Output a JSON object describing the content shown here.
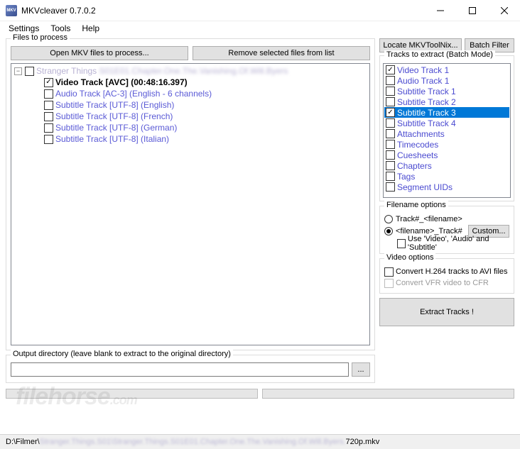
{
  "window": {
    "title": "MKVcleaver 0.7.0.2"
  },
  "menu": [
    "Settings",
    "Tools",
    "Help"
  ],
  "left": {
    "files_legend": "Files to process",
    "open_btn": "Open MKV files to process...",
    "remove_btn": "Remove selected files from list",
    "file_label_prefix": "Stranger Things ",
    "file_label_mid": "S01E01.Chapter.One.The.Vanishing.Of.Will.Byers",
    "tracks": [
      {
        "label": "Video Track [AVC] (00:48:16.397)",
        "checked": true,
        "bold": true
      },
      {
        "label": "Audio Track [AC-3] (English - 6 channels)",
        "checked": false,
        "bold": false
      },
      {
        "label": "Subtitle Track [UTF-8] (English)",
        "checked": false,
        "bold": false
      },
      {
        "label": "Subtitle Track [UTF-8] (French)",
        "checked": false,
        "bold": false
      },
      {
        "label": "Subtitle Track [UTF-8] (German)",
        "checked": false,
        "bold": false
      },
      {
        "label": "Subtitle Track [UTF-8] (Italian)",
        "checked": false,
        "bold": false
      }
    ],
    "out_legend": "Output directory (leave blank to extract to the original directory)",
    "out_value": "",
    "browse": "..."
  },
  "right": {
    "locate_btn": "Locate MKVToolNix...",
    "batch_btn": "Batch Filter",
    "tracks_legend": "Tracks to extract (Batch Mode)",
    "items": [
      {
        "label": "Video Track 1",
        "checked": true,
        "selected": false
      },
      {
        "label": "Audio Track 1",
        "checked": false,
        "selected": false
      },
      {
        "label": "Subtitle Track 1",
        "checked": false,
        "selected": false
      },
      {
        "label": "Subtitle Track 2",
        "checked": false,
        "selected": false
      },
      {
        "label": "Subtitle Track 3",
        "checked": true,
        "selected": true
      },
      {
        "label": "Subtitle Track 4",
        "checked": false,
        "selected": false
      },
      {
        "label": "Attachments",
        "checked": false,
        "selected": false
      },
      {
        "label": "Timecodes",
        "checked": false,
        "selected": false
      },
      {
        "label": "Cuesheets",
        "checked": false,
        "selected": false
      },
      {
        "label": "Chapters",
        "checked": false,
        "selected": false
      },
      {
        "label": "Tags",
        "checked": false,
        "selected": false
      },
      {
        "label": "Segment UIDs",
        "checked": false,
        "selected": false
      }
    ],
    "fname_legend": "Filename options",
    "radio1": "Track#_<filename>",
    "radio2": "<filename>_Track#",
    "custom_btn": "Custom...",
    "use_labels": "Use 'Video', 'Audio' and 'Subtitle'",
    "video_legend": "Video options",
    "vopt1": "Convert H.264 tracks to AVI files",
    "vopt2": "Convert VFR video to CFR",
    "extract_btn": "Extract Tracks !"
  },
  "status": {
    "prefix": "D:\\Filmer\\",
    "mid": "Stranger.Things.S01\\Stranger.Things.S01E01.Chapter.One.The.Vanishing.Of.Will.Byers.",
    "suffix": "720p.mkv"
  },
  "watermark": {
    "a": "filehorse",
    "b": ".com"
  }
}
